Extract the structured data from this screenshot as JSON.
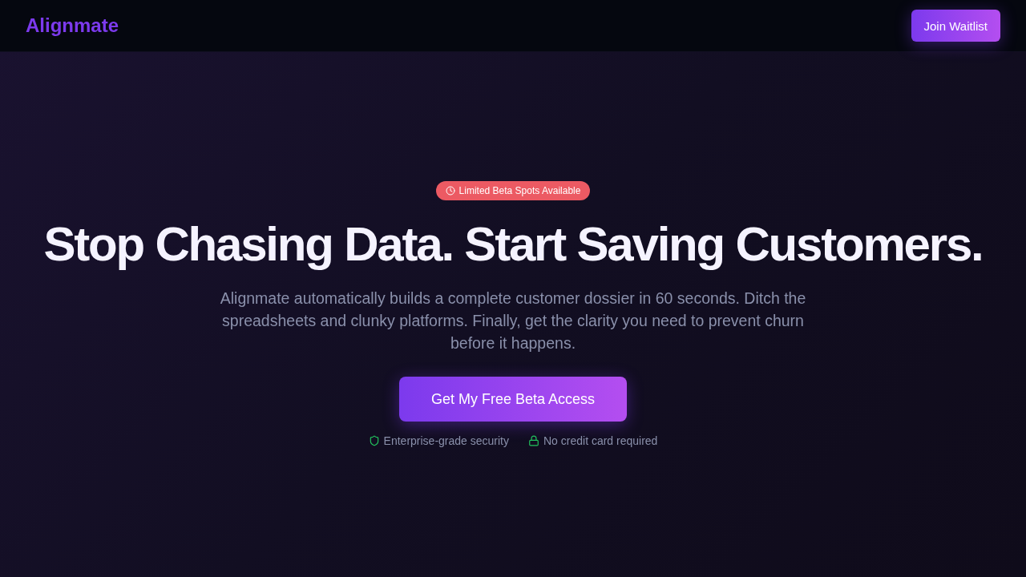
{
  "header": {
    "logo": "Alignmate",
    "cta": "Join Waitlist"
  },
  "hero": {
    "badge": "Limited Beta Spots Available",
    "headline": "Stop Chasing Data. Start Saving Customers.",
    "subtitle": "Alignmate automatically builds a complete customer dossier in 60 seconds. Ditch the spreadsheets and clunky platforms. Finally, get the clarity you need to prevent churn before it happens.",
    "cta": "Get My Free Beta Access",
    "trust": [
      {
        "kind": "shield",
        "label": "Enterprise-grade security"
      },
      {
        "kind": "lock",
        "label": "No credit card required"
      }
    ]
  }
}
